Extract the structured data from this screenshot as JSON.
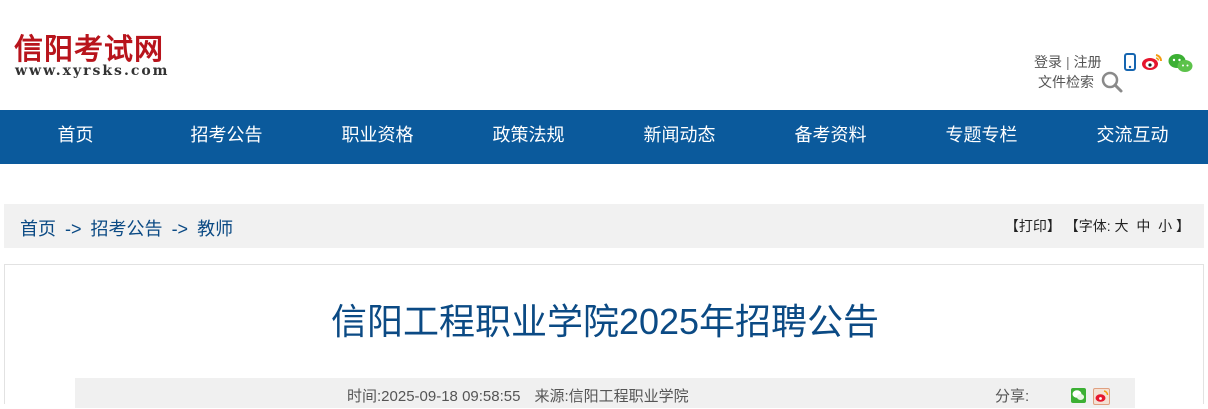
{
  "site": {
    "logo_cn": "信阳考试网",
    "logo_url": "www.xyrsks.com"
  },
  "toplinks": {
    "login": "登录",
    "separator": "|",
    "register": "注册",
    "file_search": "文件检索"
  },
  "icons": {
    "mobile": "mobile-icon",
    "weibo": "weibo-icon",
    "wechat": "wechat-icon",
    "search": "search-icon"
  },
  "nav": {
    "items": [
      "首页",
      "招考公告",
      "职业资格",
      "政策法规",
      "新闻动态",
      "备考资料",
      "专题专栏",
      "交流互动"
    ]
  },
  "breadcrumb": {
    "home": "首页",
    "arrow": "->",
    "section": "招考公告",
    "category": "教师"
  },
  "tools": {
    "print": "【打印】",
    "font_prefix": "【字体:",
    "large": "大",
    "medium": "中",
    "small": "小",
    "font_suffix": "】"
  },
  "article": {
    "title": "信阳工程职业学院2025年招聘公告",
    "time": "时间:2025-09-18 09:58:55",
    "source": "来源:信阳工程职业学院",
    "share_label": "分享:"
  },
  "colors": {
    "nav_bg": "#0b5a9c",
    "logo_red": "#b8141c",
    "title_blue": "#0b4a84",
    "breadcrumb_bg": "#f1f1f1"
  }
}
